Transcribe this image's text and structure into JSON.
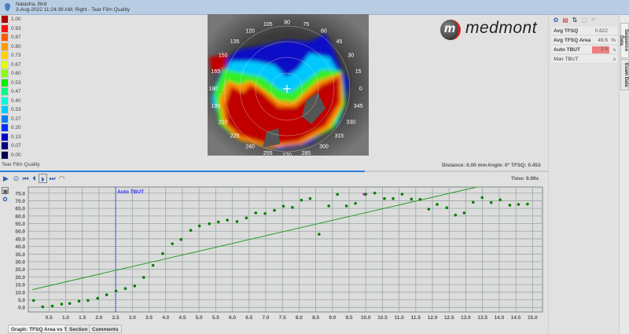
{
  "header": {
    "patient": "Natasha, Bird",
    "subtitle": "3-Aug-2022 11:24:39 AM; Right - Tear Film Quality"
  },
  "legend": {
    "title": "Tear Film Quality",
    "items": [
      {
        "label": "1.00",
        "color": "#b00000"
      },
      {
        "label": "0.93",
        "color": "#ff1010"
      },
      {
        "label": "0.87",
        "color": "#ff5a00"
      },
      {
        "label": "0.80",
        "color": "#ff9a00"
      },
      {
        "label": "0.73",
        "color": "#ffd200"
      },
      {
        "label": "0.67",
        "color": "#ddff00"
      },
      {
        "label": "0.60",
        "color": "#88ff00"
      },
      {
        "label": "0.53",
        "color": "#00ee00"
      },
      {
        "label": "0.47",
        "color": "#00ff80"
      },
      {
        "label": "0.40",
        "color": "#00ffd8"
      },
      {
        "label": "0.33",
        "color": "#00ccff"
      },
      {
        "label": "0.27",
        "color": "#0080ff"
      },
      {
        "label": "0.20",
        "color": "#0030ff"
      },
      {
        "label": "0.13",
        "color": "#0000c8"
      },
      {
        "label": "0.07",
        "color": "#000080"
      },
      {
        "label": "0.00",
        "color": "#000050"
      }
    ]
  },
  "map": {
    "angle_labels": [
      "0",
      "15",
      "30",
      "45",
      "60",
      "75",
      "90",
      "105",
      "120",
      "135",
      "150",
      "165",
      "180",
      "195",
      "210",
      "225",
      "240",
      "255",
      "270",
      "285",
      "300",
      "315",
      "330",
      "345"
    ]
  },
  "logo": "medmont",
  "status": {
    "distance_label": "Distance:",
    "distance": "0.00 mm",
    "angle_label": "Angle:",
    "angle": "0°",
    "tfsq_label": "TFSQ:",
    "tfsq": "0.453",
    "time": "Time: 9.99s",
    "progress": 0.665
  },
  "playback": {
    "play": "play",
    "record": "record",
    "first": "skip-back",
    "prev": "step-back",
    "next": "step-forward",
    "last": "skip-forward",
    "speed": "speed"
  },
  "results": {
    "rows": [
      {
        "label": "Avg TFSQ",
        "value": "0.622",
        "unit": ""
      },
      {
        "label": "Avg TFSQ Area",
        "value": "49.6",
        "unit": "%"
      },
      {
        "label": "Auto TBUT",
        "value": "2.5",
        "unit": "s"
      },
      {
        "label": "Man TBUT",
        "value": "",
        "unit": "s"
      }
    ]
  },
  "side_tabs": [
    "Sequence Data",
    "Exam Data"
  ],
  "bottom_tabs": [
    "Graph: TFSQ Area vs Time",
    "Section",
    "Comments"
  ],
  "chart_data": {
    "type": "scatter",
    "xlim": [
      -0.12,
      15.3
    ],
    "ylim": [
      -3,
      79
    ],
    "xticks": [
      0.5,
      1.0,
      1.5,
      2.0,
      2.5,
      3.0,
      3.5,
      4.0,
      4.5,
      5.0,
      5.5,
      6.0,
      6.5,
      7.0,
      7.5,
      8.0,
      8.5,
      9.0,
      9.5,
      10.0,
      10.5,
      11.0,
      11.5,
      12.0,
      12.5,
      13.0,
      13.5,
      14.0,
      14.5,
      15.0
    ],
    "yticks": [
      0,
      5,
      10,
      15,
      20,
      25,
      30,
      35,
      40,
      45,
      50,
      55,
      60,
      65,
      70,
      75
    ],
    "grid": true,
    "marker_line": {
      "x": 2.5,
      "label": "Auto TBUT",
      "color": "#3030ff"
    },
    "trend": {
      "intercept": 11.7,
      "slope": 5.05,
      "color": "#2a9a2a"
    },
    "point_color": "#008000",
    "highlight_color": "#ff00ff",
    "highlight_index": 37,
    "points": [
      [
        0.04,
        4.6
      ],
      [
        0.31,
        0.4
      ],
      [
        0.6,
        0.9
      ],
      [
        0.88,
        2.2
      ],
      [
        1.12,
        2.6
      ],
      [
        1.4,
        4.1
      ],
      [
        1.67,
        4.6
      ],
      [
        1.96,
        6.0
      ],
      [
        2.23,
        8.3
      ],
      [
        2.51,
        10.8
      ],
      [
        2.79,
        12.4
      ],
      [
        3.07,
        14.1
      ],
      [
        3.34,
        19.7
      ],
      [
        3.62,
        27.6
      ],
      [
        3.91,
        35.3
      ],
      [
        4.2,
        41.8
      ],
      [
        4.46,
        44.6
      ],
      [
        4.75,
        50.6
      ],
      [
        5.01,
        53.5
      ],
      [
        5.31,
        54.9
      ],
      [
        5.58,
        56.1
      ],
      [
        5.85,
        57.3
      ],
      [
        6.14,
        56.4
      ],
      [
        6.42,
        58.7
      ],
      [
        6.7,
        62.0
      ],
      [
        6.98,
        61.6
      ],
      [
        7.26,
        63.7
      ],
      [
        7.53,
        66.4
      ],
      [
        7.8,
        65.6
      ],
      [
        8.07,
        70.4
      ],
      [
        8.33,
        71.4
      ],
      [
        8.6,
        48.0
      ],
      [
        8.89,
        66.6
      ],
      [
        9.15,
        74.2
      ],
      [
        9.42,
        66.6
      ],
      [
        9.69,
        68.3
      ],
      [
        9.95,
        74.3
      ],
      [
        10.0,
        74.3
      ],
      [
        10.27,
        75.0
      ],
      [
        10.56,
        71.4
      ],
      [
        10.82,
        71.4
      ],
      [
        11.09,
        74.3
      ],
      [
        11.37,
        71.1
      ],
      [
        11.63,
        70.9
      ],
      [
        11.89,
        64.5
      ],
      [
        12.14,
        67.6
      ],
      [
        12.43,
        65.4
      ],
      [
        12.69,
        60.6
      ],
      [
        12.95,
        62.0
      ],
      [
        13.22,
        69.0
      ],
      [
        13.49,
        72.1
      ],
      [
        13.76,
        68.8
      ],
      [
        14.03,
        70.6
      ],
      [
        14.32,
        67.1
      ],
      [
        14.58,
        67.6
      ],
      [
        14.85,
        67.8
      ]
    ]
  }
}
